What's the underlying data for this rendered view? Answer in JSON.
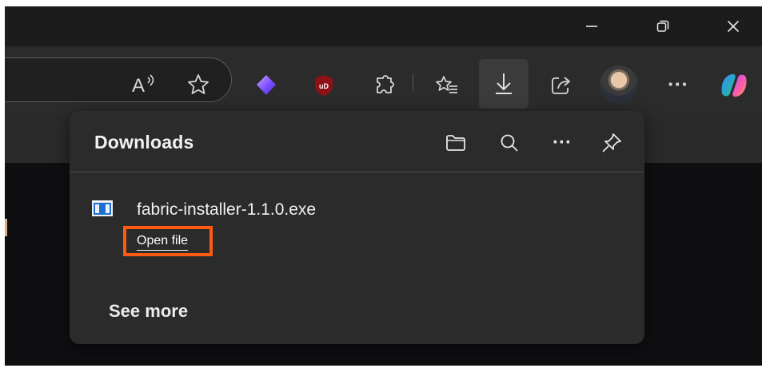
{
  "window": {
    "controls": [
      "minimize-icon",
      "restore-icon",
      "close-icon"
    ]
  },
  "toolbar": {
    "icons": [
      "read-aloud-icon",
      "favorite-star-icon",
      "copilot-designer-extension-icon",
      "ublock-origin-extension-icon",
      "extensions-puzzle-icon",
      "favorites-list-icon",
      "downloads-icon",
      "share-icon",
      "profile-avatar",
      "more-options-icon",
      "copilot-icon"
    ],
    "read_aloud_label": "A",
    "ublock_label": "uD",
    "more_label": "···"
  },
  "downloads_panel": {
    "title": "Downloads",
    "header_icons": [
      "open-folder-icon",
      "search-icon",
      "more-options-icon",
      "pin-icon"
    ],
    "more_label": "···",
    "items": [
      {
        "file_name": "fabric-installer-1.1.0.exe",
        "action_label": "Open file",
        "icon": "exe-file-icon"
      }
    ],
    "see_more_label": "See more"
  },
  "colors": {
    "panel_background": "#2b2b2b",
    "highlight_box": "#ff5a13",
    "text_primary": "#f0f0f0",
    "toolbar_background": "#2b2b2b",
    "titlebar_background": "#1c1c1c"
  }
}
